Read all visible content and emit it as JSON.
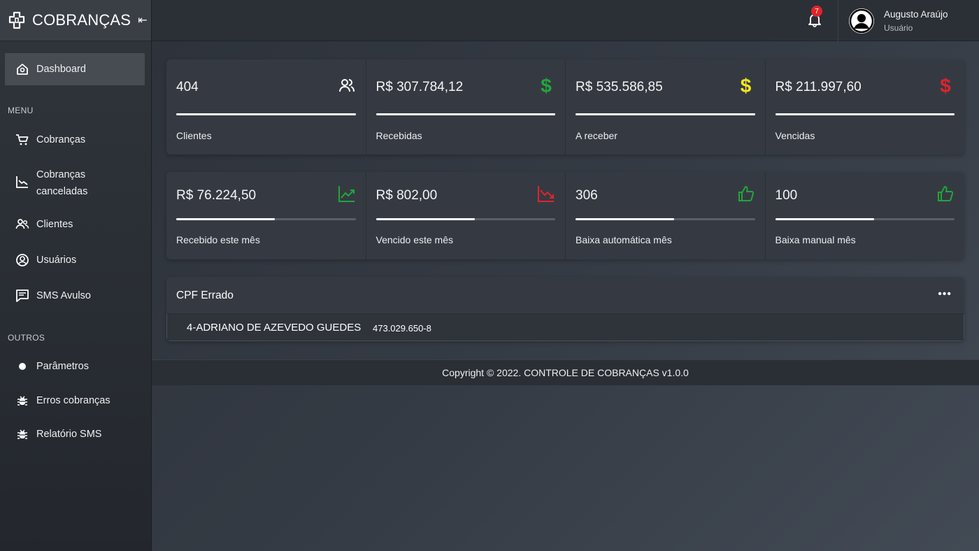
{
  "brand": {
    "title": "COBRANÇAS",
    "collapse_icon": "collapse-left-icon"
  },
  "sidebar": {
    "items": [
      {
        "label": "Dashboard",
        "icon": "home-icon"
      },
      {
        "label": "Cobranças",
        "icon": "cart-icon"
      },
      {
        "label_line1": "Cobranças",
        "label_line2": "canceladas",
        "icon": "chart-down-icon"
      },
      {
        "label": "Clientes",
        "icon": "users-icon"
      },
      {
        "label": "Usuários",
        "icon": "user-circle-icon"
      },
      {
        "label": "SMS Avulso",
        "icon": "message-icon"
      },
      {
        "label": "Parâmetros",
        "icon": "dot-icon"
      },
      {
        "label": "Erros cobranças",
        "icon": "bug-icon"
      },
      {
        "label": "Relatório SMS",
        "icon": "bug-icon"
      }
    ],
    "sections": {
      "menu": "MENU",
      "outros": "OUTROS"
    }
  },
  "topbar": {
    "notifications_count": "7",
    "user_name": "Augusto Araújo",
    "user_role": "Usuário"
  },
  "cards_row1": [
    {
      "value": "404",
      "label": "Clientes",
      "icon": "users-icon",
      "progress": 1.0,
      "icon_color": "#ffffff"
    },
    {
      "value": "R$ 307.784,12",
      "label": "Recebidas",
      "icon": "dollar-icon",
      "progress": 1.0,
      "icon_color": "#22a63a"
    },
    {
      "value": "R$ 535.586,85",
      "label": "A receber",
      "icon": "dollar-icon",
      "progress": 1.0,
      "icon_color": "#f2e81b"
    },
    {
      "value": "R$ 211.997,60",
      "label": "Vencidas",
      "icon": "dollar-icon",
      "progress": 1.0,
      "icon_color": "#e0242c"
    }
  ],
  "cards_row2": [
    {
      "value": "R$ 76.224,50",
      "label": "Recebido este mês",
      "icon": "trend-up-icon",
      "progress": 0.55,
      "icon_color": "#22a63a"
    },
    {
      "value": "R$ 802,00",
      "label": "Vencido este mês",
      "icon": "trend-down-icon",
      "progress": 0.55,
      "icon_color": "#e0242c"
    },
    {
      "value": "306",
      "label": "Baixa automática mês",
      "icon": "thumbs-up-icon",
      "progress": 0.55,
      "icon_color": "#22a63a"
    },
    {
      "value": "100",
      "label": "Baixa manual mês",
      "icon": "thumbs-up-icon",
      "progress": 0.55,
      "icon_color": "#22a63a"
    }
  ],
  "cpf_panel": {
    "title": "CPF Errado",
    "more": "•••",
    "rows": [
      {
        "name": "4-ADRIANO DE AZEVEDO GUEDES",
        "doc": "473.029.650-8"
      }
    ]
  },
  "footer": {
    "text": "Copyright © 2022. CONTROLE DE COBRANÇAS v1.0.0"
  }
}
